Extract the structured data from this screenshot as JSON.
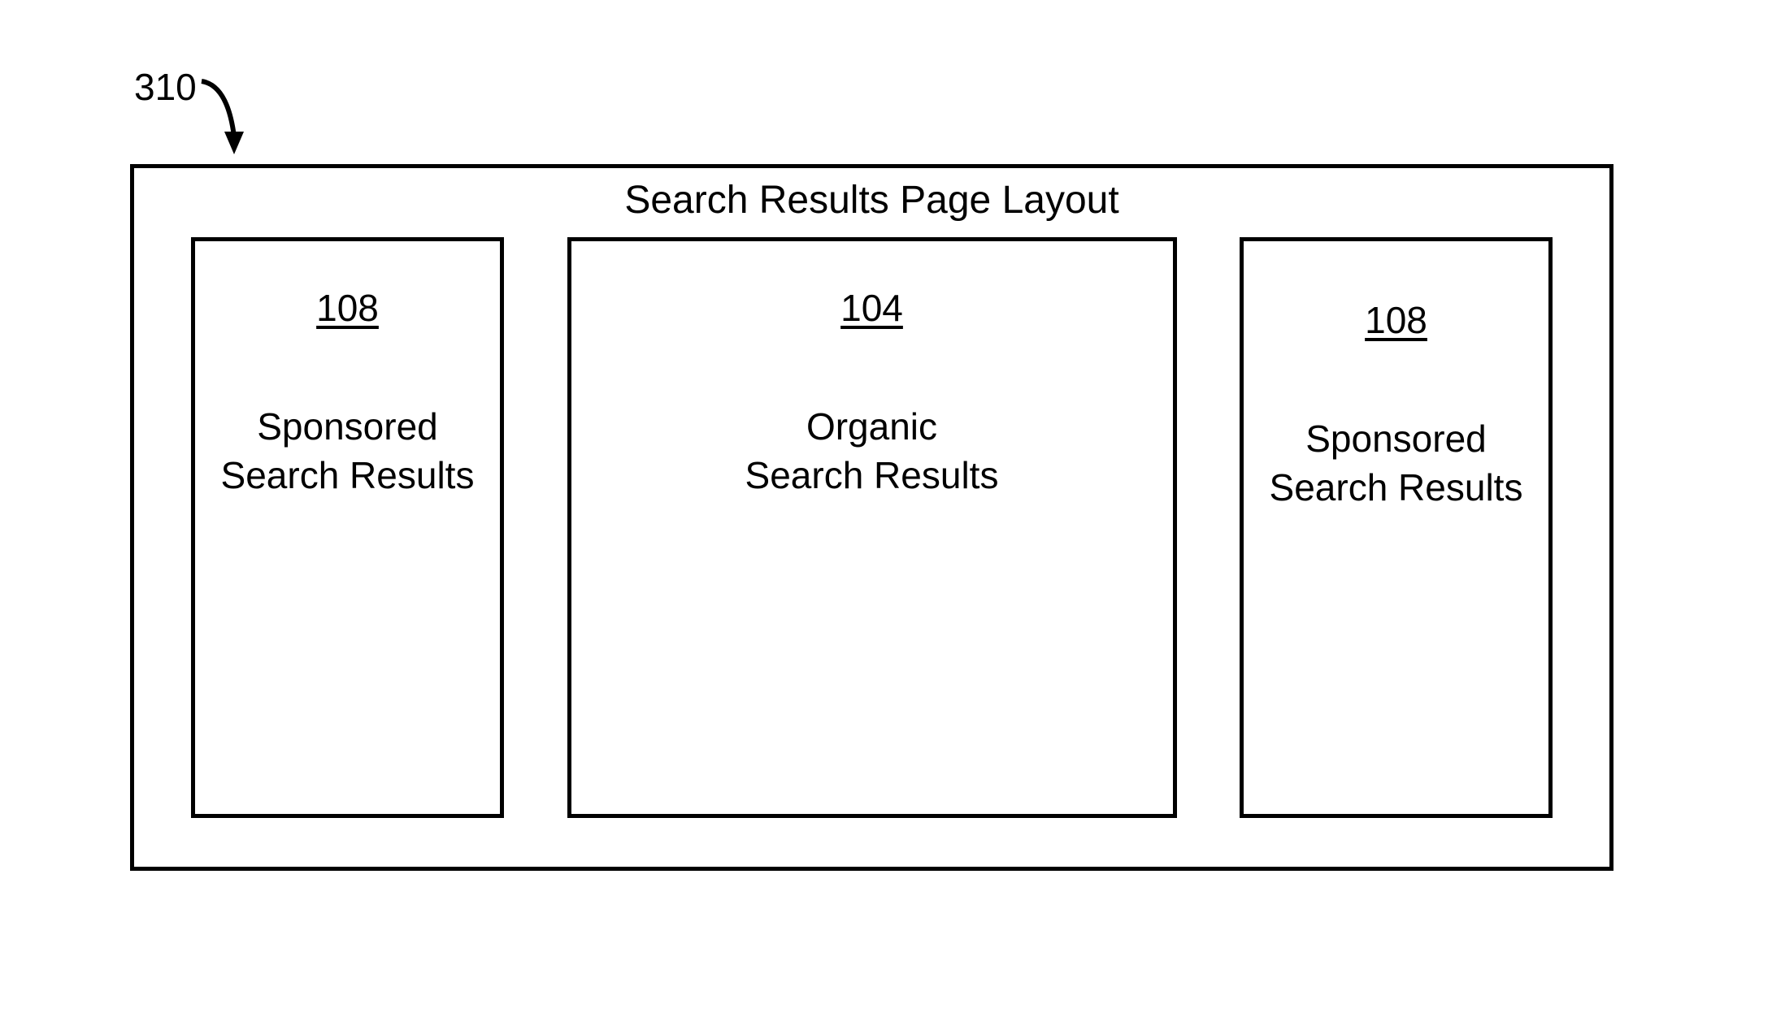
{
  "figure": {
    "reference_number": "310"
  },
  "container": {
    "title": "Search Results Page Layout"
  },
  "panels": {
    "left": {
      "ref": "108",
      "line1": "Sponsored",
      "line2": "Search Results"
    },
    "center": {
      "ref": "104",
      "line1": "Organic",
      "line2": "Search Results"
    },
    "right": {
      "ref": "108",
      "line1": "Sponsored",
      "line2": "Search Results"
    }
  }
}
